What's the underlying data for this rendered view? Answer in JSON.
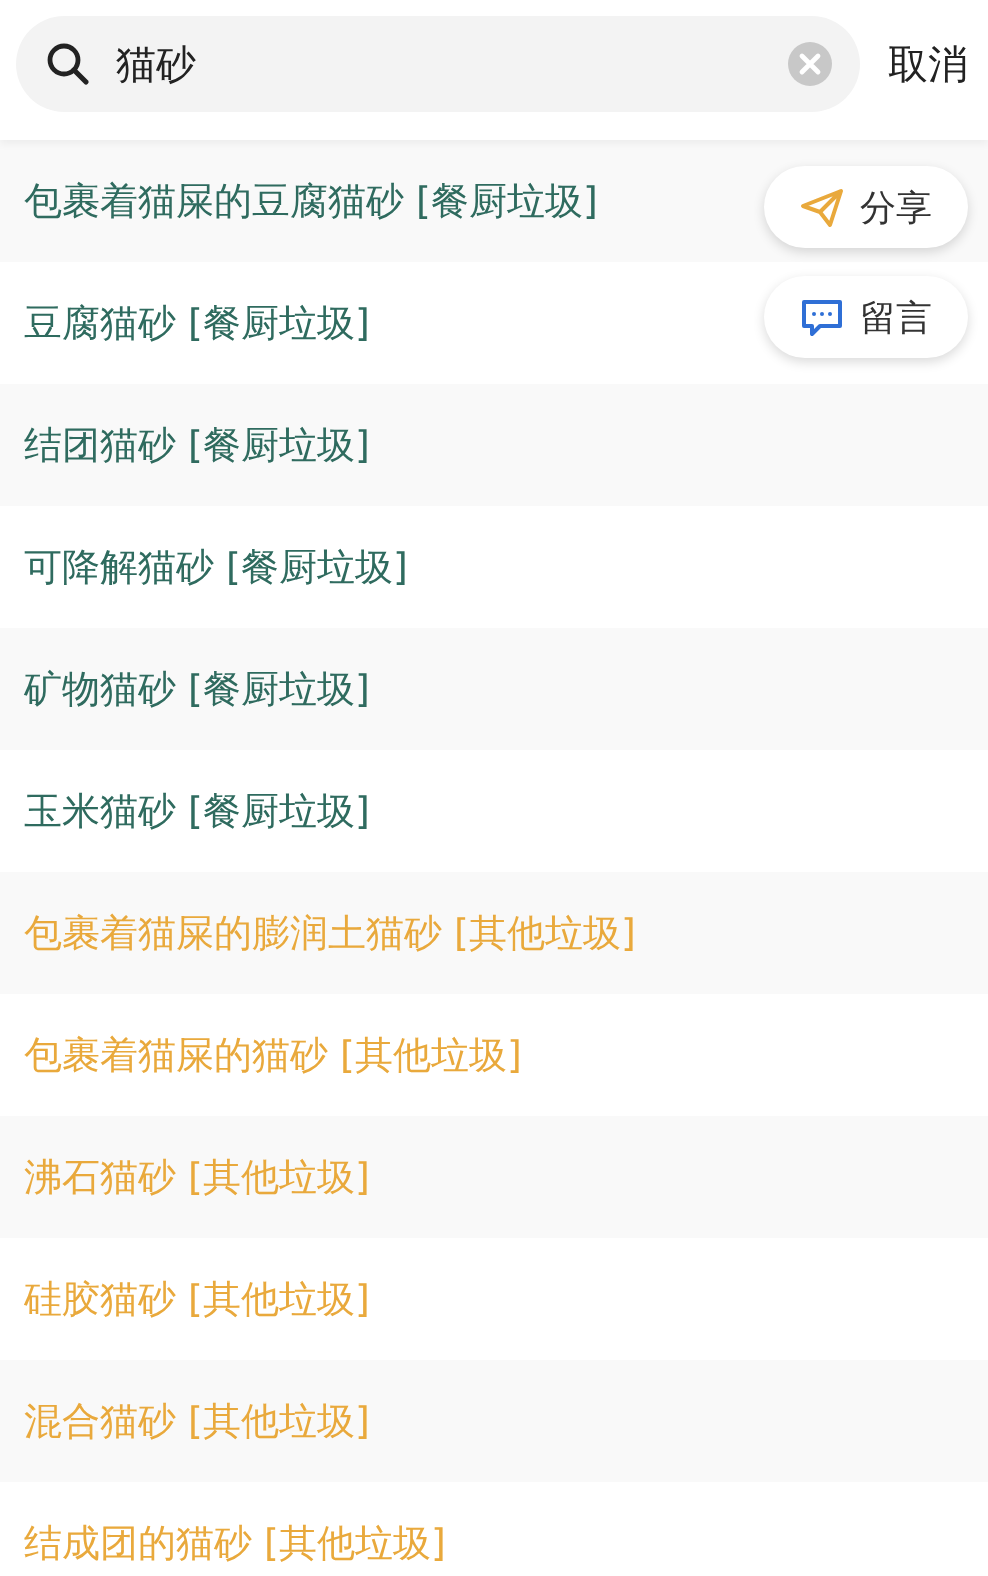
{
  "search": {
    "value": "猫砂",
    "cancel": "取消"
  },
  "results": [
    {
      "text": "包裹着猫屎的豆腐猫砂 [餐厨垃圾]",
      "color": "#2f6b5f"
    },
    {
      "text": "豆腐猫砂 [餐厨垃圾]",
      "color": "#2f6b5f"
    },
    {
      "text": "结团猫砂 [餐厨垃圾]",
      "color": "#2f6b5f"
    },
    {
      "text": "可降解猫砂 [餐厨垃圾]",
      "color": "#2f6b5f"
    },
    {
      "text": "矿物猫砂 [餐厨垃圾]",
      "color": "#2f6b5f"
    },
    {
      "text": "玉米猫砂 [餐厨垃圾]",
      "color": "#2f6b5f"
    },
    {
      "text": "包裹着猫屎的膨润土猫砂 [其他垃圾]",
      "color": "#e9a93c"
    },
    {
      "text": "包裹着猫屎的猫砂 [其他垃圾]",
      "color": "#e9a93c"
    },
    {
      "text": "沸石猫砂 [其他垃圾]",
      "color": "#e9a93c"
    },
    {
      "text": "硅胶猫砂 [其他垃圾]",
      "color": "#e9a93c"
    },
    {
      "text": "混合猫砂 [其他垃圾]",
      "color": "#e9a93c"
    },
    {
      "text": "结成团的猫砂 [其他垃圾]",
      "color": "#e9a93c"
    }
  ],
  "floating_actions": [
    {
      "kind": "share",
      "label": "分享"
    },
    {
      "kind": "comment",
      "label": "留言"
    }
  ]
}
